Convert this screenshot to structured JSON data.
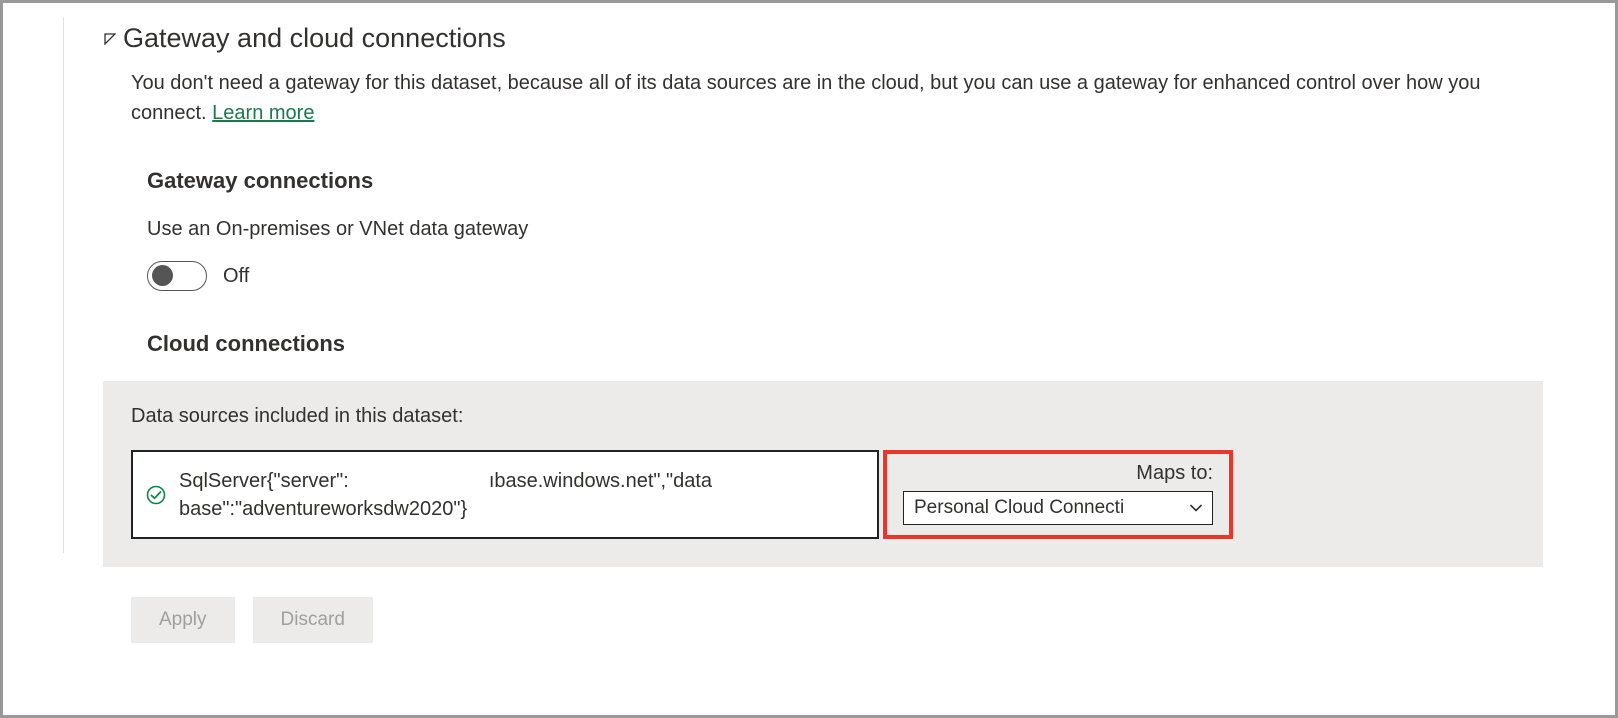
{
  "section": {
    "title": "Gateway and cloud connections",
    "description_prefix": "You don't need a gateway for this dataset, because all of its data sources are in the cloud, but you can use a gateway for enhanced control over how you connect. ",
    "learn_more": "Learn more"
  },
  "gateway": {
    "title": "Gateway connections",
    "toggle_label": "Use an On-premises or VNet data gateway",
    "toggle_state": "Off",
    "toggle_on": false
  },
  "cloud": {
    "title": "Cloud connections",
    "datasources_label": "Data sources included in this dataset:",
    "item": {
      "status": "ok",
      "text_line1_a": "SqlServer{\"server\":",
      "text_line1_b": "ıbase.windows.net\",\"data",
      "text_line2": "base\":\"adventureworksdw2020\"}",
      "maps_to_label": "Maps to:",
      "maps_to_value": "Personal Cloud Connecti"
    }
  },
  "buttons": {
    "apply": "Apply",
    "discard": "Discard"
  }
}
